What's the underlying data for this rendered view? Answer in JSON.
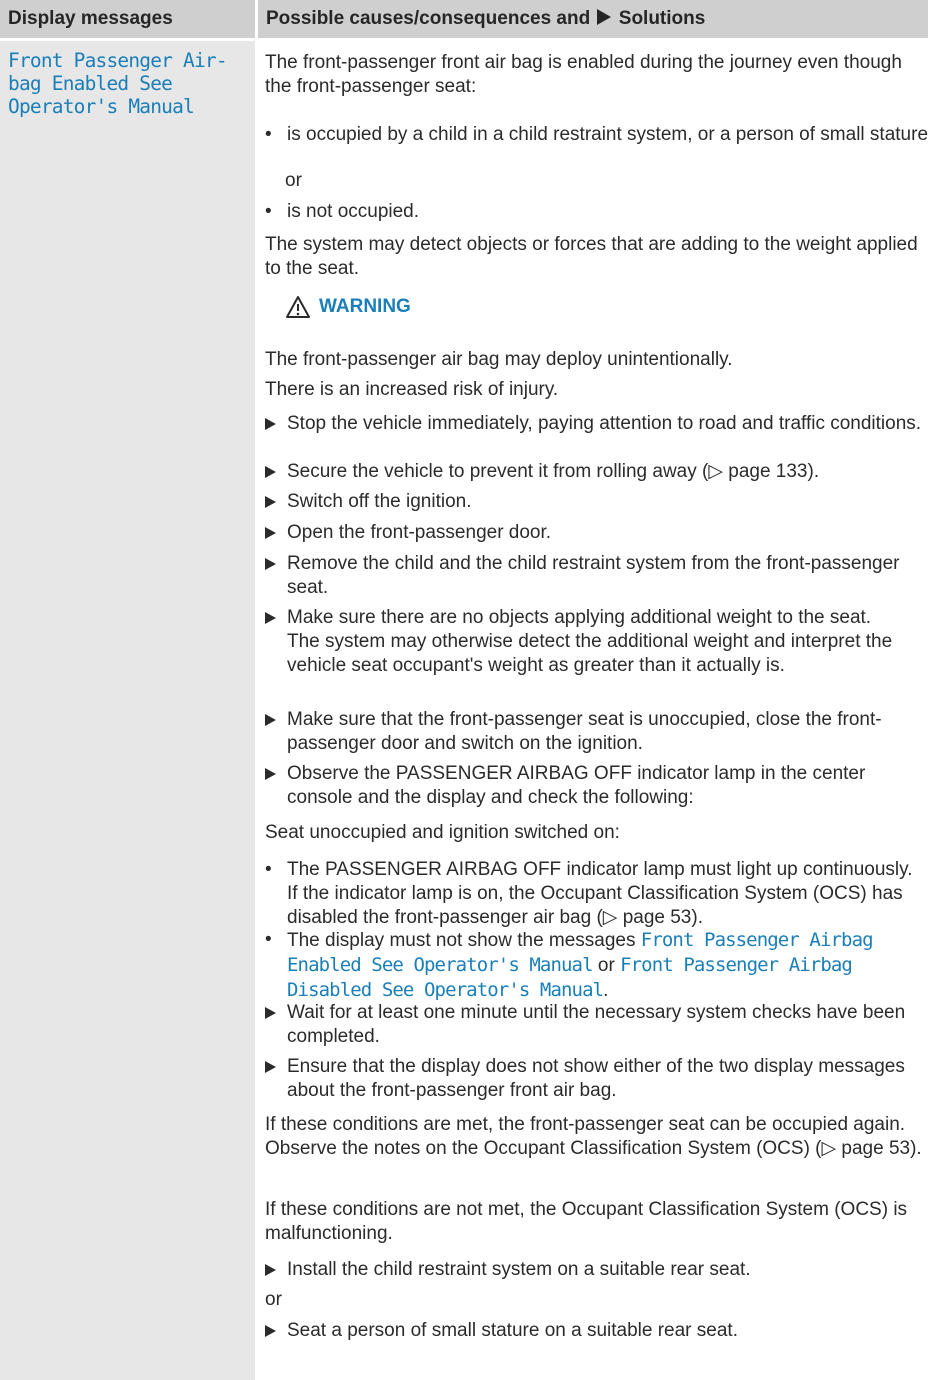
{
  "header": {
    "col1": "Display messages",
    "col2_prefix": "Possible causes/consequences and",
    "col2_suffix": "Solutions"
  },
  "message": "Front Passenger Air-\nbag Enabled See\nOperator's Manual",
  "intro": "The front-passenger front air bag is enabled during the journey even though the front-passenger seat:",
  "bullet1": "is occupied by a child in a child restraint system, or a person of small stature",
  "or1": "or",
  "bullet2": "is not occupied.",
  "para_detect": "The system may detect objects or forces that are adding to the weight applied to the seat.",
  "warning": {
    "icon": "warning-triangle-icon",
    "label": "WARNING",
    "line1": "The front-passenger air bag may deploy unintentionally.",
    "line2": "There is an increased risk of injury."
  },
  "steps": [
    "Stop the vehicle immediately, paying attention to road and traffic conditions.",
    "Secure the vehicle to prevent it from rolling away (▷ page 133).",
    "Switch off the ignition.",
    "Open the front-passenger door.",
    "Remove the child and the child restraint system from the front-passenger seat.",
    "Make sure there are no objects applying additional weight to the seat.",
    "Make sure that the front-passenger seat is unoccupied, close the front-passenger door and switch on the ignition.",
    "Observe the PASSENGER AIRBAG OFF indicator lamp in the center console and the display and check the following:"
  ],
  "step6_note": "The system may otherwise detect the additional weight and interpret the vehicle seat occupant's weight as greater than it actually is.",
  "seat_unoccupied": "Seat unoccupied and ignition switched on:",
  "check1": "The PASSENGER AIRBAG OFF indicator lamp must light up continuously. If the indicator lamp is on, the Occupant Classification System (OCS) has disabled the front-passenger air bag (▷ page 53).",
  "check2": {
    "prefix": "The display must not show the messages",
    "msg1": "Front Passenger Airbag Enabled See Operator's Manual",
    "joiner": "or",
    "msg2": "Front Passenger Airbag Disabled See Operator's Manual",
    "suffix": "."
  },
  "steps2": [
    "Wait for at least one minute until the necessary system checks have been completed.",
    "Ensure that the display does not show either of the two display messages about the front-passenger front air bag."
  ],
  "para_met": "If these conditions are met, the front-passenger seat can be occupied again. Observe the notes on the Occupant Classification System (OCS) (▷ page 53).",
  "para_notmet": "If these conditions are not met, the Occupant Classification System (OCS) is malfunctioning.",
  "final_step1": "Install the child restraint system on a suitable rear seat.",
  "or2": "or",
  "final_step2": "Seat a person of small stature on a suitable rear seat."
}
